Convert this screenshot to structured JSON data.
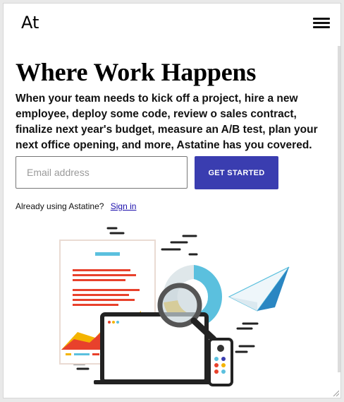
{
  "header": {
    "logo_text": "At",
    "menu_icon": "hamburger-menu-icon"
  },
  "hero": {
    "headline": "Where Work Happens",
    "subtext": "When your team needs to kick off a project, hire a new employee, deploy some code, review o sales contract, finalize next year's budget, measure an A/B test, plan your next office opening, and more, Astatine has you covered."
  },
  "signup": {
    "email_placeholder": "Email address",
    "email_value": "",
    "cta_label": "GET STARTED"
  },
  "signin": {
    "prompt": "Already using Astatine?",
    "link_label": "Sign in"
  },
  "colors": {
    "cta": "#3a3db0",
    "accent_red": "#e8412c",
    "accent_blue": "#5bc0de",
    "accent_yellow": "#f4b400",
    "dark": "#222222"
  }
}
